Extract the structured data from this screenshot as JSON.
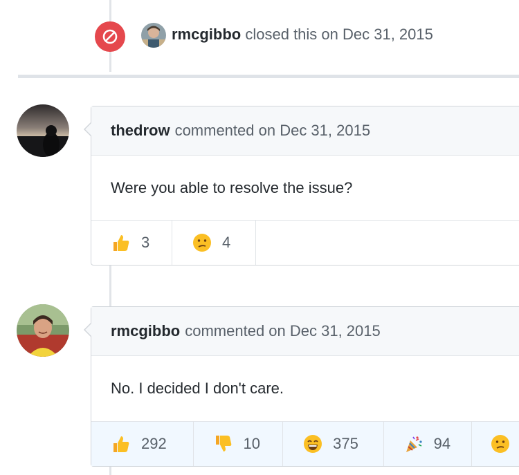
{
  "close_event": {
    "user": "rmcgibbo",
    "action": "closed this on Dec 31, 2015",
    "badge_color": "#e5484d"
  },
  "comments": [
    {
      "user": "thedrow",
      "meta": "commented on Dec 31, 2015",
      "body": "Were you able to resolve the issue?",
      "reactions": [
        {
          "icon": "thumbs-up-icon",
          "count": "3"
        },
        {
          "icon": "confused-face-icon",
          "count": "4"
        }
      ]
    },
    {
      "user": "rmcgibbo",
      "meta": "commented on Dec 31, 2015",
      "body": "No. I decided I don't care.",
      "reactions": [
        {
          "icon": "thumbs-up-icon",
          "count": "292"
        },
        {
          "icon": "thumbs-down-icon",
          "count": "10"
        },
        {
          "icon": "laugh-face-icon",
          "count": "375"
        },
        {
          "icon": "party-popper-icon",
          "count": "94"
        },
        {
          "icon": "confused-face-icon",
          "count": ""
        }
      ]
    }
  ],
  "colors": {
    "header_bg": "#f6f8fa",
    "border": "#d1d5da",
    "reacted_bg": "#f1f8ff",
    "emoji_yellow": "#fbbf24"
  }
}
